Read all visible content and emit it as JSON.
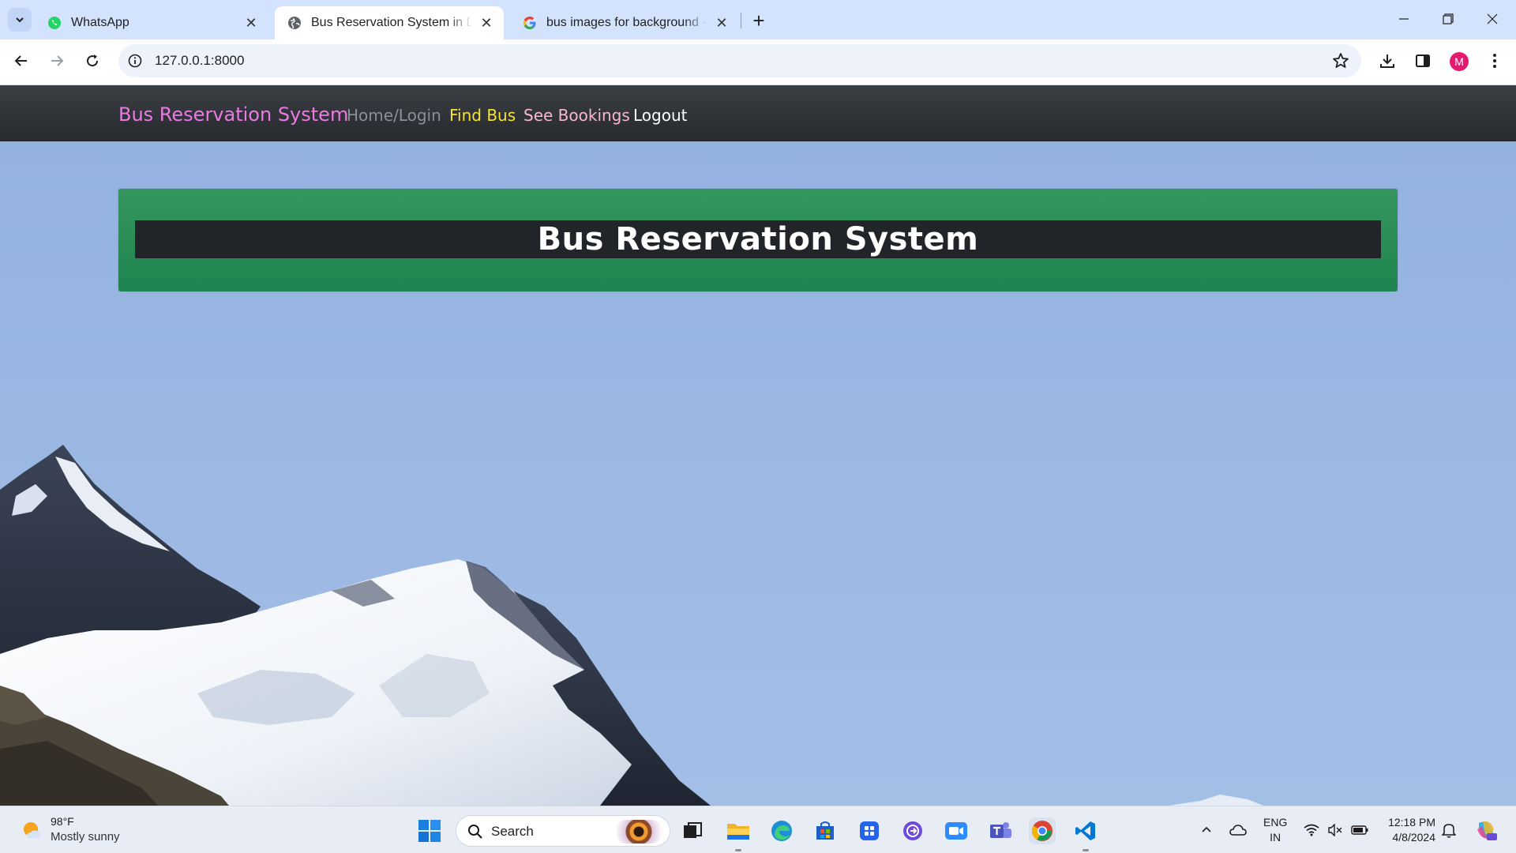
{
  "browser": {
    "tabs": [
      {
        "title": "WhatsApp"
      },
      {
        "title": "Bus Reservation System in Djan"
      },
      {
        "title": "bus images for background - G"
      }
    ],
    "url": "127.0.0.1:8000",
    "profile_initial": "M"
  },
  "site": {
    "brand": "Bus Reservation System",
    "nav": {
      "home": "Home/Login",
      "find_bus": "Find Bus",
      "see_bookings": "See Bookings",
      "logout": "Logout"
    },
    "hero_title": "Bus Reservation System"
  },
  "taskbar": {
    "weather_temp": "98°F",
    "weather_desc": "Mostly sunny",
    "search_placeholder": "Search",
    "lang_line1": "ENG",
    "lang_line2": "IN",
    "time": "12:18 PM",
    "date": "4/8/2024"
  },
  "colors": {
    "brand": "#e97be2",
    "nav_find_bus": "#f5e337",
    "nav_see_bookings": "#f7b7d3",
    "hero_green": "#28894f",
    "hero_bar": "#212529"
  }
}
